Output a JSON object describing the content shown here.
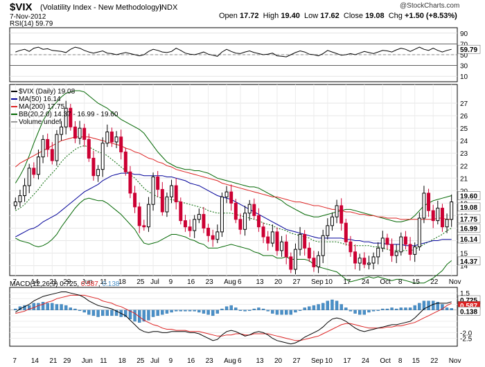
{
  "header": {
    "symbol": "$VIX",
    "name": "(Volatility Index - New Methodology)",
    "exchange": "INDX",
    "date": "7-Nov-2012",
    "open_label": "Open",
    "open": "17.72",
    "high_label": "High",
    "high": "19.40",
    "low_label": "Low",
    "low": "17.62",
    "close_label": "Close",
    "close": "19.08",
    "chg_label": "Chg",
    "chg": "+1.50 (+8.53%)",
    "copyright": "@StockCharts.com"
  },
  "colors": {
    "up": "#000000",
    "down": "#cc0033",
    "ma50": "#000099",
    "ma200": "#dd2222",
    "bb": "#006600",
    "macd_hist": "#4a90c8",
    "macd": "#000000",
    "signal": "#dd2222"
  },
  "chart_data": [
    {
      "type": "line",
      "panel": "RSI",
      "legend": "RSI(14) 59.79",
      "ylim": [
        0,
        100
      ],
      "yticks": [
        10,
        30,
        50,
        70,
        90
      ],
      "levels": [
        30,
        70
      ],
      "last_value_label": "59.79",
      "series": [
        {
          "name": "RSI(14)",
          "values": [
            55,
            58,
            60,
            56,
            62,
            64,
            60,
            61,
            58,
            57,
            56,
            54,
            60,
            64,
            62,
            58,
            55,
            53,
            55,
            57,
            53,
            52,
            50,
            52,
            54,
            52,
            50,
            48,
            50,
            56,
            60,
            58,
            55,
            54,
            56,
            62,
            58,
            53,
            51,
            50,
            52,
            55,
            51,
            49,
            47,
            55,
            60,
            56,
            53,
            52,
            55,
            57,
            54,
            52,
            50,
            51,
            53,
            48,
            47,
            46,
            50,
            54,
            57,
            55,
            51,
            50,
            48,
            52,
            58,
            55,
            52,
            49,
            50,
            52,
            50,
            53,
            56,
            54,
            52,
            55,
            58,
            57,
            55,
            59,
            62,
            60,
            56,
            60,
            64,
            60,
            58,
            62,
            58,
            55,
            58,
            60
          ]
        }
      ]
    },
    {
      "type": "candlestick",
      "panel": "Price",
      "legend": "$VIX (Daily) 19.08",
      "ylim": [
        13.2,
        28.5
      ],
      "yticks": [
        14,
        15,
        16,
        17,
        18,
        19,
        20,
        21,
        22,
        23,
        24,
        25,
        26,
        27
      ],
      "x_tick_labels": [
        "7",
        "14",
        "21",
        "29",
        "Jun",
        "11",
        "18",
        "25",
        "Jul",
        "9",
        "16",
        "23",
        "Aug",
        "6",
        "13",
        "20",
        "27",
        "Sep",
        "10",
        "17",
        "24",
        "Oct",
        "8",
        "15",
        "22",
        "Nov"
      ],
      "overlays": [
        {
          "name": "MA(50)",
          "legend": "MA(50) 16.14",
          "last_value_label": "16.14"
        },
        {
          "name": "MA(200)",
          "legend": "MA(200) 17.75",
          "last_value_label": "17.75"
        },
        {
          "name": "BB(20,2.0)",
          "legend": "BB(20,2.0) 14.37 - 16.99 - 19.60",
          "last_value_labels": [
            "19.60",
            "16.99",
            "14.37"
          ]
        },
        {
          "name": "Volume",
          "legend": "Volume undef"
        }
      ],
      "last_close_label": "19.08",
      "close": [
        19.1,
        19.6,
        20.4,
        21.8,
        21.3,
        22.7,
        24.1,
        23.3,
        22.4,
        24.5,
        25.1,
        26.6,
        25.1,
        24.2,
        25.0,
        24.1,
        22.6,
        21.2,
        21.7,
        23.8,
        24.7,
        23.9,
        24.3,
        23.1,
        21.5,
        19.8,
        18.7,
        17.2,
        17.1,
        18.9,
        21.1,
        20.1,
        18.3,
        19.5,
        20.4,
        19.1,
        17.6,
        17.1,
        16.8,
        17.7,
        18.1,
        17.0,
        16.4,
        16.1,
        16.7,
        19.5,
        19.9,
        19.0,
        17.7,
        16.9,
        18.2,
        18.9,
        18.0,
        17.1,
        16.3,
        15.8,
        16.7,
        15.2,
        15.9,
        14.7,
        13.7,
        15.3,
        16.5,
        15.4,
        14.6,
        13.9,
        14.8,
        16.4,
        17.2,
        17.9,
        18.8,
        17.4,
        15.9,
        15.1,
        14.2,
        14.6,
        14.1,
        14.2,
        14.7,
        15.4,
        16.2,
        15.7,
        14.8,
        15.1,
        16.3,
        15.7,
        14.9,
        15.5,
        17.8,
        19.8,
        18.4,
        17.6,
        18.6,
        17.1,
        17.7,
        19.1
      ],
      "ma50": [
        16.3,
        16.5,
        16.7,
        16.9,
        17.0,
        17.2,
        17.5,
        17.7,
        17.9,
        18.1,
        18.4,
        18.7,
        19.0,
        19.3,
        19.6,
        19.9,
        20.1,
        20.3,
        20.5,
        20.8,
        21.0,
        21.2,
        21.3,
        21.4,
        21.4,
        21.4,
        21.3,
        21.3,
        21.2,
        21.2,
        21.2,
        21.2,
        21.2,
        21.1,
        21.1,
        21.0,
        20.9,
        20.8,
        20.6,
        20.5,
        20.4,
        20.2,
        20.0,
        19.8,
        19.6,
        19.5,
        19.4,
        19.3,
        19.1,
        18.9,
        18.7,
        18.5,
        18.3,
        18.1,
        17.9,
        17.7,
        17.5,
        17.3,
        17.1,
        16.9,
        16.8,
        16.7,
        16.6,
        16.5,
        16.4,
        16.3,
        16.2,
        16.2,
        16.2,
        16.2,
        16.2,
        16.2,
        16.1,
        16.1,
        16.0,
        16.0,
        15.9,
        15.9,
        15.8,
        15.8,
        15.8,
        15.7,
        15.7,
        15.7,
        15.7,
        15.6,
        15.6,
        15.6,
        15.7,
        15.8,
        15.9,
        16.0,
        16.0,
        16.1,
        16.1,
        16.1
      ],
      "ma200": [
        21.9,
        22.2,
        22.4,
        22.6,
        22.8,
        23.0,
        23.2,
        23.4,
        23.6,
        23.8,
        24.0,
        24.1,
        24.2,
        24.3,
        24.3,
        24.3,
        24.3,
        24.2,
        24.1,
        24.0,
        23.9,
        23.8,
        23.7,
        23.6,
        23.4,
        23.3,
        23.1,
        23.0,
        22.8,
        22.6,
        22.5,
        22.3,
        22.2,
        22.0,
        21.9,
        21.7,
        21.6,
        21.5,
        21.4,
        21.3,
        21.2,
        21.1,
        21.0,
        20.9,
        20.8,
        20.6,
        20.5,
        20.4,
        20.3,
        20.2,
        20.1,
        20.0,
        19.9,
        19.8,
        19.7,
        19.6,
        19.5,
        19.5,
        19.4,
        19.3,
        19.2,
        19.1,
        19.1,
        19.0,
        18.9,
        18.8,
        18.8,
        18.7,
        18.6,
        18.5,
        18.5,
        18.4,
        18.3,
        18.3,
        18.2,
        18.1,
        18.1,
        18.0,
        18.0,
        17.9,
        17.9,
        17.8,
        17.8,
        17.8,
        17.7,
        17.7,
        17.7,
        17.7,
        17.7,
        17.7,
        17.7,
        17.7,
        17.8,
        17.8,
        17.7,
        17.7
      ],
      "bb_mid": [
        18.4,
        18.6,
        18.9,
        19.3,
        19.7,
        20.1,
        20.6,
        21.0,
        21.4,
        21.8,
        22.3,
        22.7,
        23.0,
        23.3,
        23.5,
        23.6,
        23.5,
        23.3,
        23.1,
        23.0,
        22.8,
        22.5,
        22.2,
        21.9,
        21.6,
        21.3,
        21.0,
        20.6,
        20.2,
        19.9,
        19.7,
        19.5,
        19.4,
        19.3,
        19.3,
        19.2,
        19.1,
        19.0,
        18.9,
        18.8,
        18.7,
        18.6,
        18.4,
        18.3,
        18.2,
        18.2,
        18.2,
        18.2,
        18.1,
        18.0,
        17.9,
        17.8,
        17.7,
        17.6,
        17.4,
        17.3,
        17.2,
        17.0,
        16.9,
        16.8,
        16.6,
        16.5,
        16.4,
        16.3,
        16.2,
        16.0,
        15.9,
        15.9,
        15.9,
        15.9,
        15.9,
        15.8,
        15.7,
        15.6,
        15.6,
        15.6,
        15.6,
        15.6,
        15.5,
        15.5,
        15.4,
        15.3,
        15.2,
        15.2,
        15.2,
        15.2,
        15.2,
        15.3,
        15.5,
        15.7,
        15.9,
        16.1,
        16.3,
        16.5,
        16.8,
        17.0
      ],
      "bb_upper": [
        20.6,
        21.2,
        21.9,
        22.8,
        23.8,
        24.7,
        25.6,
        26.2,
        26.7,
        27.1,
        27.5,
        27.8,
        27.9,
        28.0,
        28.0,
        27.9,
        27.6,
        27.3,
        27.0,
        26.8,
        26.6,
        26.3,
        26.0,
        25.7,
        25.5,
        25.3,
        25.1,
        24.9,
        24.6,
        24.1,
        23.6,
        23.1,
        22.7,
        22.3,
        22.1,
        21.9,
        21.8,
        21.7,
        21.7,
        21.6,
        21.6,
        21.5,
        21.4,
        21.2,
        21.0,
        20.9,
        20.8,
        20.7,
        20.6,
        20.5,
        20.4,
        20.3,
        20.3,
        20.2,
        20.0,
        19.8,
        19.6,
        19.4,
        19.2,
        18.9,
        18.7,
        18.5,
        18.3,
        18.1,
        18.0,
        17.9,
        17.9,
        18.0,
        18.1,
        18.2,
        18.3,
        18.4,
        18.5,
        18.5,
        18.4,
        18.3,
        18.2,
        18.1,
        18.0,
        17.9,
        17.8,
        17.7,
        17.6,
        17.5,
        17.5,
        17.6,
        17.7,
        18.0,
        18.4,
        18.8,
        19.0,
        19.2,
        19.3,
        19.4,
        19.5,
        19.6
      ],
      "bb_lower": [
        16.2,
        16.0,
        15.9,
        15.8,
        15.6,
        15.5,
        15.6,
        15.8,
        16.1,
        16.5,
        17.1,
        17.6,
        18.1,
        18.6,
        19.0,
        19.3,
        19.4,
        19.3,
        19.2,
        19.2,
        19.0,
        18.7,
        18.4,
        18.1,
        17.7,
        17.3,
        16.9,
        16.3,
        15.8,
        15.7,
        15.8,
        15.9,
        16.1,
        16.3,
        16.5,
        16.5,
        16.4,
        16.3,
        16.1,
        16.0,
        15.8,
        15.7,
        15.4,
        15.4,
        15.4,
        15.5,
        15.6,
        15.7,
        15.6,
        15.5,
        15.4,
        15.3,
        15.1,
        15.0,
        14.8,
        14.8,
        14.8,
        14.6,
        14.6,
        14.7,
        14.5,
        14.5,
        14.5,
        14.5,
        14.4,
        14.1,
        13.9,
        13.8,
        13.7,
        13.6,
        13.5,
        13.2,
        12.9,
        12.7,
        12.8,
        12.9,
        13.0,
        13.1,
        13.0,
        13.1,
        13.0,
        12.9,
        12.8,
        12.9,
        12.9,
        12.8,
        12.7,
        12.6,
        12.6,
        12.6,
        12.8,
        13.0,
        13.3,
        13.6,
        14.1,
        14.4
      ]
    },
    {
      "type": "line",
      "panel": "MACD",
      "legend_label": "MACD(12,26,9)",
      "legend_values": [
        "0.725",
        "0.587",
        "0.138"
      ],
      "ylim": [
        -3.2,
        2.0
      ],
      "yticks": [
        -2.5,
        -2.0,
        -1.5,
        -1.0,
        -0.5,
        0.5,
        1.0,
        1.5
      ],
      "tick_labels_shown": [
        "1.5",
        "1.0",
        "-2.0",
        "-2.5"
      ],
      "last_value_labels": [
        "0.725",
        "0.587",
        "0.138"
      ],
      "x_tick_labels": [
        "7",
        "14",
        "21",
        "29",
        "Jun",
        "11",
        "18",
        "25",
        "Jul",
        "9",
        "16",
        "23",
        "Aug",
        "6",
        "13",
        "20",
        "27",
        "Sep",
        "10",
        "17",
        "24",
        "Oct",
        "8",
        "15",
        "22",
        "Nov"
      ],
      "series": [
        {
          "name": "MACD",
          "values": [
            -0.2,
            0.1,
            0.3,
            0.5,
            0.8,
            1.0,
            1.2,
            1.3,
            1.4,
            1.5,
            1.6,
            1.6,
            1.5,
            1.4,
            1.3,
            1.1,
            0.8,
            0.6,
            0.4,
            0.3,
            0.2,
            0.1,
            -0.1,
            -0.3,
            -0.5,
            -0.9,
            -1.3,
            -1.7,
            -1.9,
            -2.0,
            -1.9,
            -1.9,
            -2.0,
            -2.0,
            -1.9,
            -1.9,
            -1.9,
            -1.9,
            -2.0,
            -2.0,
            -2.1,
            -2.3,
            -2.5,
            -2.7,
            -2.6,
            -2.2,
            -1.9,
            -1.8,
            -1.9,
            -2.1,
            -2.3,
            -2.2,
            -2.0,
            -1.9,
            -2.0,
            -2.2,
            -2.5,
            -2.7,
            -2.8,
            -2.9,
            -3.0,
            -2.9,
            -2.7,
            -2.4,
            -2.2,
            -2.0,
            -1.8,
            -1.5,
            -1.1,
            -0.8,
            -0.7,
            -0.8,
            -1.0,
            -1.3,
            -1.6,
            -1.8,
            -1.9,
            -1.8,
            -1.7,
            -1.6,
            -1.5,
            -1.4,
            -1.3,
            -1.3,
            -1.2,
            -1.1,
            -1.0,
            -0.7,
            -0.3,
            0.1,
            0.3,
            0.5,
            0.6,
            0.6,
            0.6,
            0.73
          ]
        },
        {
          "name": "Signal",
          "values": [
            -0.3,
            -0.2,
            -0.1,
            0.1,
            0.2,
            0.4,
            0.5,
            0.7,
            0.8,
            1.0,
            1.1,
            1.2,
            1.3,
            1.3,
            1.3,
            1.3,
            1.2,
            1.1,
            1.0,
            0.8,
            0.7,
            0.6,
            0.4,
            0.3,
            0.1,
            -0.1,
            -0.3,
            -0.6,
            -0.9,
            -1.1,
            -1.3,
            -1.4,
            -1.6,
            -1.7,
            -1.7,
            -1.8,
            -1.8,
            -1.8,
            -1.9,
            -1.9,
            -1.9,
            -2.0,
            -2.1,
            -2.2,
            -2.3,
            -2.3,
            -2.2,
            -2.2,
            -2.1,
            -2.1,
            -2.2,
            -2.2,
            -2.1,
            -2.1,
            -2.1,
            -2.1,
            -2.2,
            -2.3,
            -2.4,
            -2.5,
            -2.6,
            -2.7,
            -2.7,
            -2.6,
            -2.5,
            -2.4,
            -2.3,
            -2.1,
            -1.9,
            -1.7,
            -1.5,
            -1.3,
            -1.2,
            -1.2,
            -1.3,
            -1.4,
            -1.5,
            -1.6,
            -1.6,
            -1.6,
            -1.6,
            -1.5,
            -1.5,
            -1.4,
            -1.4,
            -1.3,
            -1.2,
            -1.1,
            -0.9,
            -0.7,
            -0.5,
            -0.3,
            -0.1,
            0.1,
            0.4,
            0.59
          ]
        },
        {
          "name": "Histogram",
          "values": [
            0.1,
            0.3,
            0.4,
            0.4,
            0.6,
            0.6,
            0.7,
            0.6,
            0.6,
            0.5,
            0.5,
            0.4,
            0.2,
            0.1,
            0.0,
            -0.2,
            -0.4,
            -0.5,
            -0.6,
            -0.5,
            -0.5,
            -0.5,
            -0.5,
            -0.6,
            -0.6,
            -0.8,
            -1.0,
            -1.1,
            -1.0,
            -0.9,
            -0.6,
            -0.5,
            -0.4,
            -0.3,
            -0.2,
            -0.1,
            -0.1,
            -0.1,
            -0.1,
            -0.1,
            -0.2,
            -0.3,
            -0.4,
            -0.5,
            -0.3,
            0.1,
            0.3,
            0.4,
            0.2,
            0.0,
            -0.1,
            0.0,
            0.1,
            0.2,
            0.1,
            -0.1,
            -0.3,
            -0.4,
            -0.4,
            -0.4,
            -0.4,
            -0.2,
            0.0,
            0.2,
            0.3,
            0.4,
            0.5,
            0.6,
            0.8,
            0.9,
            0.8,
            0.5,
            0.2,
            -0.1,
            -0.3,
            -0.4,
            -0.4,
            -0.2,
            -0.1,
            0.0,
            0.1,
            0.1,
            0.2,
            0.1,
            0.2,
            0.2,
            0.2,
            0.4,
            0.6,
            0.8,
            0.8,
            0.8,
            0.7,
            0.5,
            0.2,
            0.14
          ]
        }
      ]
    }
  ]
}
